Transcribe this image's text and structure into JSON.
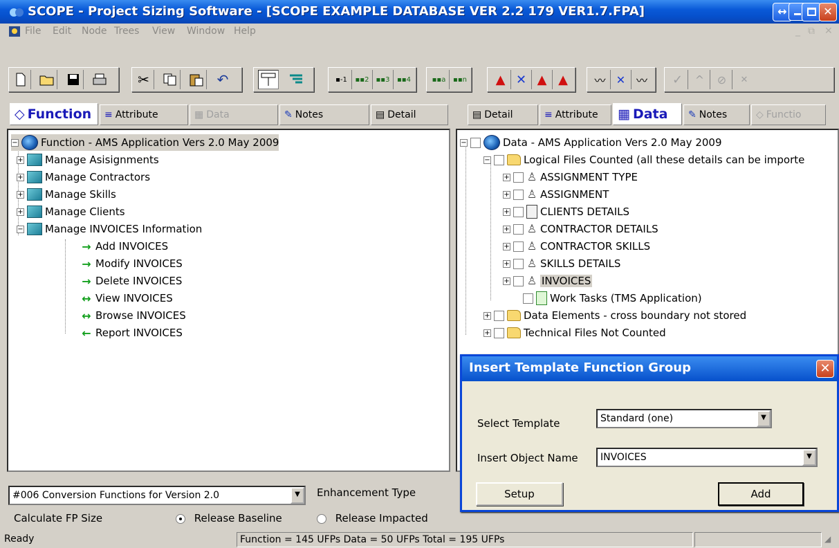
{
  "window": {
    "title": "SCOPE - Project Sizing Software  - [SCOPE EXAMPLE DATABASE VER 2.2 179 VER1.7.FPA]",
    "restore_glyph": "↔",
    "close_glyph": "✕"
  },
  "menu": {
    "items": [
      "File",
      "Edit",
      "Node",
      "Trees",
      "View",
      "Window",
      "Help"
    ]
  },
  "left_tabs": [
    {
      "label": "Function",
      "icon": "function-icon"
    },
    {
      "label": "Attribute",
      "icon": "attribute-icon"
    },
    {
      "label": "Data",
      "icon": "data-icon"
    },
    {
      "label": "Notes",
      "icon": "notes-icon"
    },
    {
      "label": "Detail",
      "icon": "detail-icon"
    }
  ],
  "right_tabs": [
    {
      "label": "Detail",
      "icon": "detail-icon"
    },
    {
      "label": "Attribute",
      "icon": "attribute-icon"
    },
    {
      "label": "Data",
      "icon": "data-icon"
    },
    {
      "label": "Notes",
      "icon": "notes-icon"
    },
    {
      "label": "Functio",
      "icon": "function-icon"
    }
  ],
  "function_tree": {
    "root": "Function - AMS Application  Vers 2.0  May 2009",
    "groups": [
      "Manage Asisignments",
      "Manage Contractors",
      "Manage Skills",
      "Manage Clients",
      "Manage INVOICES Information"
    ],
    "children": [
      {
        "label": "Add INVOICES",
        "arrow": "→"
      },
      {
        "label": "Modify INVOICES",
        "arrow": "→"
      },
      {
        "label": "Delete INVOICES",
        "arrow": "→"
      },
      {
        "label": "View INVOICES",
        "arrow": "↔"
      },
      {
        "label": "Browse INVOICES",
        "arrow": "↔"
      },
      {
        "label": "Report INVOICES",
        "arrow": "←"
      }
    ]
  },
  "data_tree": {
    "root": "Data - AMS Application  Vers 2.0  May 2009",
    "logical_files": "Logical Files Counted (all these details can be importe",
    "files": [
      {
        "label": "ASSIGNMENT TYPE",
        "icon": "pen-icon"
      },
      {
        "label": "ASSIGNMENT",
        "icon": "pen-icon"
      },
      {
        "label": "CLIENTS  DETAILS",
        "icon": "document-icon"
      },
      {
        "label": "CONTRACTOR DETAILS",
        "icon": "pen-icon"
      },
      {
        "label": "CONTRACTOR SKILLS",
        "icon": "pen-icon"
      },
      {
        "label": "SKILLS DETAILS",
        "icon": "pen-icon"
      },
      {
        "label": "INVOICES",
        "icon": "pen-icon"
      },
      {
        "label": "Work Tasks (TMS Application)",
        "icon": "green-document-icon"
      }
    ],
    "others": [
      "Data Elements - cross boundary not stored",
      "Technical Files Not Counted"
    ]
  },
  "bottom": {
    "release_combo": "#006 Conversion Functions for Version 2.0",
    "enhancement_label": "Enhancement Type",
    "calc_label": "Calculate FP Size",
    "radio_baseline": "Release Baseline",
    "radio_impacted": "Release Impacted"
  },
  "status": {
    "ready": "Ready",
    "totals": "Function = 145 UFPs   Data = 50 UFPs   Total = 195 UFPs"
  },
  "dialog": {
    "title": "Insert Template Function Group",
    "select_label": "Select Template",
    "select_value": "Standard  (one)",
    "name_label": "Insert Object Name",
    "name_value": "INVOICES",
    "setup_label": "Setup",
    "add_label": "Add"
  },
  "colors": {
    "title_blue": "#0650cc",
    "active_tab_text": "#1a1ab8",
    "arrow_green": "#14a01e",
    "face": "#d4d0c8"
  }
}
